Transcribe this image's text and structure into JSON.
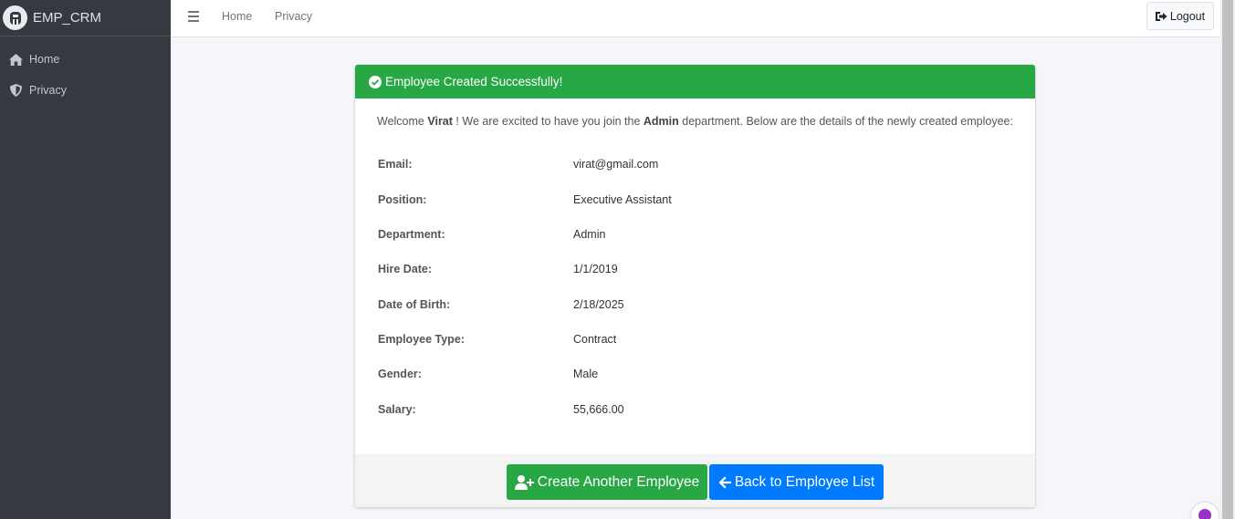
{
  "brand": {
    "name": "EMP_CRM"
  },
  "sidebar": {
    "items": [
      {
        "label": "Home",
        "icon": "home-icon"
      },
      {
        "label": "Privacy",
        "icon": "shield-icon"
      }
    ]
  },
  "topbar": {
    "links": [
      "Home",
      "Privacy"
    ],
    "logout_label": "Logout"
  },
  "card": {
    "header": "Employee Created Successfully!",
    "welcome": {
      "prefix": "Welcome",
      "name": "Virat",
      "middle": "! We are excited to have you join the",
      "department": "Admin",
      "suffix": "department. Below are the details of the newly created employee:"
    },
    "details": [
      {
        "label": "Email:",
        "value": "virat@gmail.com"
      },
      {
        "label": "Position:",
        "value": "Executive Assistant"
      },
      {
        "label": "Department:",
        "value": "Admin"
      },
      {
        "label": "Hire Date:",
        "value": "1/1/2019"
      },
      {
        "label": "Date of Birth:",
        "value": "2/18/2025"
      },
      {
        "label": "Employee Type:",
        "value": "Contract"
      },
      {
        "label": "Gender:",
        "value": "Male"
      },
      {
        "label": "Salary:",
        "value": "55,666.00"
      }
    ],
    "buttons": {
      "create_another": "Create Another Employee",
      "back_to_list": "Back to Employee List"
    }
  },
  "colors": {
    "success": "#28a745",
    "primary": "#007bff",
    "sidebar_bg": "#343a40"
  }
}
